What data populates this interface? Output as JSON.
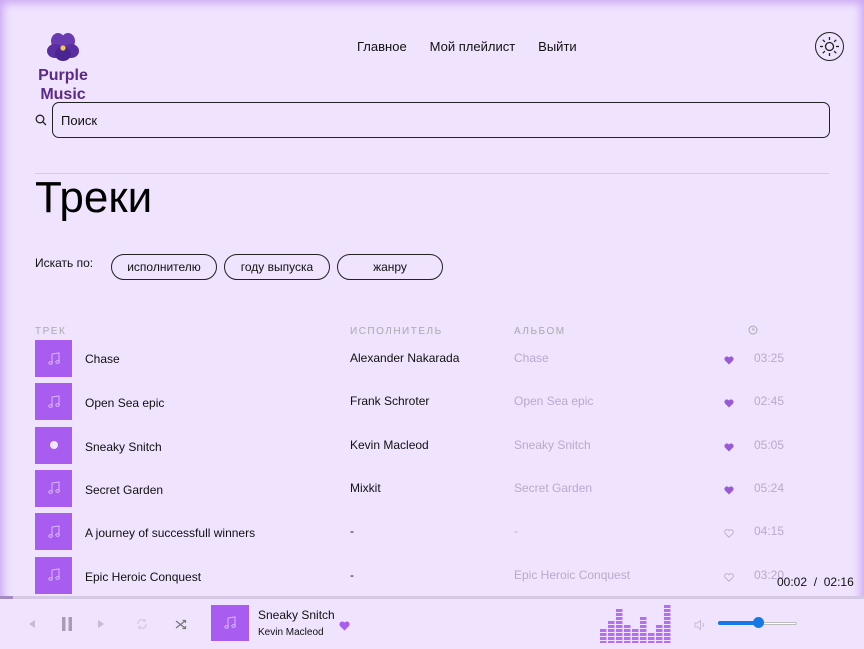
{
  "app": {
    "logo_line1": "Purple",
    "logo_line2": "Music",
    "logo_icon": "pansy-flower-icon"
  },
  "nav": {
    "items": [
      "Главное",
      "Мой плейлист",
      "Выйти"
    ],
    "theme_icon": "sun-icon"
  },
  "search": {
    "placeholder": "Поиск",
    "value": "",
    "icon": "search-icon"
  },
  "page": {
    "title": "Треки"
  },
  "filters": {
    "label": "Искать по:",
    "buttons": [
      "исполнителю",
      "году выпуска",
      "жанру"
    ]
  },
  "table": {
    "headers": {
      "track": "ТРЕК",
      "artist": "ИСПОЛНИТЕЛЬ",
      "album": "АЛЬБОМ",
      "duration_icon": "clock-icon"
    },
    "rows": [
      {
        "title": "Chase",
        "artist": "Alexander Nakarada",
        "album": "Chase",
        "liked": true,
        "duration": "03:25",
        "playing": false
      },
      {
        "title": "Open Sea epic",
        "artist": "Frank Schroter",
        "album": "Open Sea epic",
        "liked": true,
        "duration": "02:45",
        "playing": false
      },
      {
        "title": "Sneaky Snitch",
        "artist": "Kevin Macleod",
        "album": "Sneaky Snitch",
        "liked": true,
        "duration": "05:05",
        "playing": true
      },
      {
        "title": "Secret Garden",
        "artist": "Mixkit",
        "album": "Secret Garden",
        "liked": true,
        "duration": "05:24",
        "playing": false
      },
      {
        "title": "A journey of successfull winners",
        "artist": "-",
        "album": "-",
        "liked": false,
        "duration": "04:15",
        "playing": false
      },
      {
        "title": "Epic Heroic Conquest",
        "artist": "-",
        "album": "Epic Heroic Conquest",
        "liked": false,
        "duration": "03:20",
        "playing": false
      }
    ]
  },
  "player": {
    "current_time": "00:02",
    "separator": "/",
    "total_time": "02:16",
    "progress_fraction": 0.015,
    "track_title": "Sneaky Snitch",
    "track_artist": "Kevin Macleod",
    "liked": true,
    "volume_fraction": 0.5,
    "icons": [
      "prev-icon",
      "pause-icon",
      "next-icon",
      "repeat-icon",
      "shuffle-icon",
      "equalizer-icon",
      "volume-icon"
    ]
  },
  "colors": {
    "background": "#efe3fd",
    "accent": "#a85cf0",
    "logo": "#5b2a86",
    "muted": "#bba9cd",
    "volume": "#1677e6"
  }
}
